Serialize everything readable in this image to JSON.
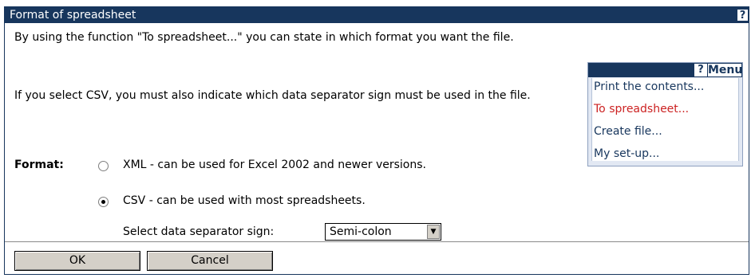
{
  "dialog": {
    "title": "Format of spreadsheet",
    "help_label": "?"
  },
  "intro": {
    "para1": "By using the function \"To spreadsheet...\" you can state in which format you want the file.",
    "para2": "If you select CSV, you must also indicate which data separator sign must be used in the file."
  },
  "format": {
    "label": "Format:",
    "options": [
      {
        "label": "XML - can be used for Excel 2002 and newer versions.",
        "selected": false
      },
      {
        "label": "CSV - can be used with most spreadsheets.",
        "selected": true
      }
    ],
    "separator_label": "Select data separator sign:",
    "separator_value": "Semi-colon"
  },
  "menu": {
    "help_label": "?",
    "title": "Menu",
    "items": [
      {
        "label": "Print the contents...",
        "active": false
      },
      {
        "label": "To spreadsheet...",
        "active": true
      },
      {
        "label": "Create file...",
        "active": false
      },
      {
        "label": "My set-up...",
        "active": false
      }
    ]
  },
  "buttons": {
    "ok": "OK",
    "cancel": "Cancel"
  },
  "colors": {
    "titlebar": "#17365d",
    "active_menu_item": "#cc2222"
  }
}
